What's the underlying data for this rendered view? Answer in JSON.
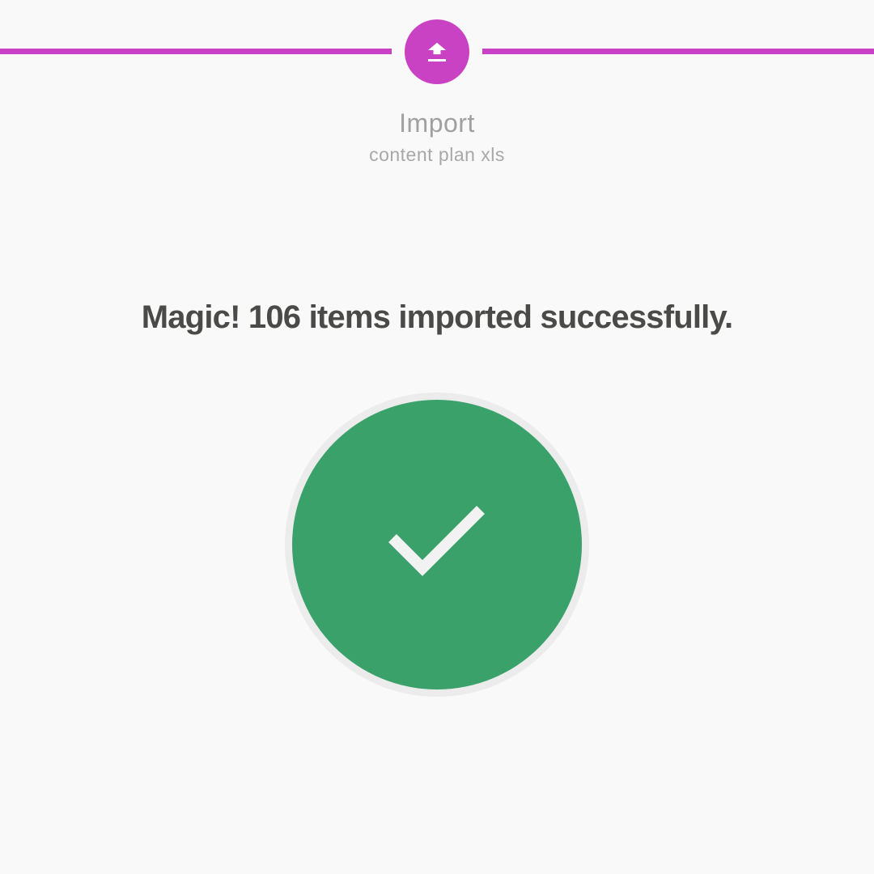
{
  "stepper": {
    "accent_color": "#c842c3",
    "step_icon": "upload-icon",
    "step_title": "Import",
    "step_subtitle": "content plan xls"
  },
  "result": {
    "message": "Magic! 106 items imported successfully.",
    "status_icon": "checkmark-icon",
    "status_color": "#3aa16a"
  }
}
